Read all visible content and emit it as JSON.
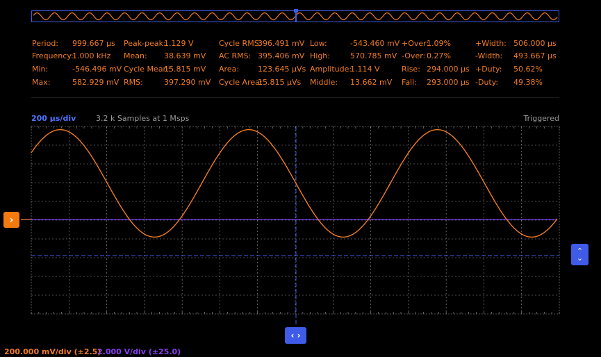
{
  "measurements": [
    {
      "label": "Period:",
      "value": "999.667 µs"
    },
    {
      "label": "Frequency:",
      "value": "1.000 kHz"
    },
    {
      "label": "Min:",
      "value": "-546.496 mV"
    },
    {
      "label": "Max:",
      "value": "582.929 mV"
    },
    {
      "label": "Peak-peak:",
      "value": "1.129 V"
    },
    {
      "label": "Mean:",
      "value": "38.639 mV"
    },
    {
      "label": "Cycle Mean:",
      "value": "15.815 mV"
    },
    {
      "label": "RMS:",
      "value": "397.290 mV"
    },
    {
      "label": "Cycle RMS:",
      "value": "396.491 mV"
    },
    {
      "label": "AC RMS:",
      "value": "395.406 mV"
    },
    {
      "label": "Area:",
      "value": "123.645 µVs"
    },
    {
      "label": "Cycle Area:",
      "value": "15.815 µVs"
    },
    {
      "label": "Low:",
      "value": "-543.460 mV"
    },
    {
      "label": "High:",
      "value": "570.785 mV"
    },
    {
      "label": "Amplitude:",
      "value": "1.114 V"
    },
    {
      "label": "Middle:",
      "value": "13.662 mV"
    },
    {
      "label": "+Over:",
      "value": "1.09%"
    },
    {
      "label": "-Over:",
      "value": "0.27%"
    },
    {
      "label": "Rise:",
      "value": "294.000 µs"
    },
    {
      "label": "Fall:",
      "value": "293.000 µs"
    },
    {
      "label": "+Width:",
      "value": "506.000 µs"
    },
    {
      "label": "-Width:",
      "value": "493.667 µs"
    },
    {
      "label": "+Duty:",
      "value": "50.62%"
    },
    {
      "label": "-Duty:",
      "value": "49.38%"
    }
  ],
  "timebase": "200 µs/div",
  "samples": "3.2 k Samples at 1 Msps",
  "trigger_status": "Triggered",
  "channels": [
    {
      "label": "200.000 mV/div (±2.5)",
      "color": "#f07c22"
    },
    {
      "label": "2.000 V/div (±25.0)",
      "color": "#8a3ef0"
    }
  ],
  "colors": {
    "ch1": "#f07c22",
    "ch2": "#7b3ff0",
    "cursor": "#3f5be8",
    "grid": "#9a9a9a"
  },
  "buttons": {
    "left_marker_icon": "›",
    "horizontal_pan_icon": "‹ ›",
    "vertical_up_icon": "⌃",
    "vertical_down_icon": "⌄"
  },
  "chart_data": {
    "type": "line",
    "series": [
      {
        "frequency_khz": 1.0,
        "amplitude_mv": 573,
        "offset_mv": 14,
        "color": "#f07c22"
      },
      {
        "level_v": 0,
        "color": "#8a3ef0"
      }
    ],
    "time_per_div_us": 200,
    "volts_per_div_mv": 200,
    "x_divisions": 14,
    "y_divisions": 10
  }
}
